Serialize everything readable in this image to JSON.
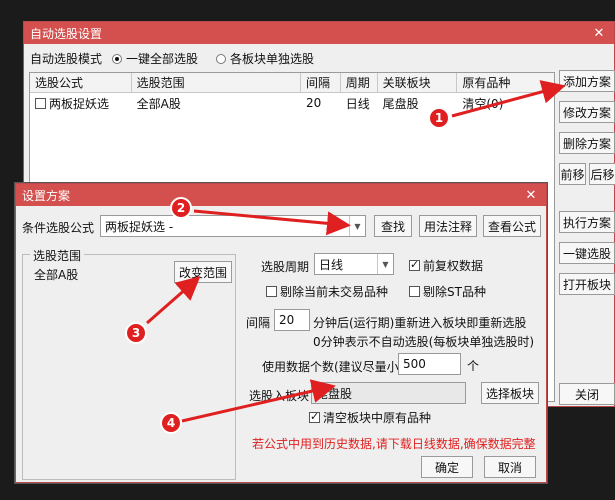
{
  "back_window": {
    "title": "自动选股设置",
    "mode_label": "自动选股模式",
    "mode_options": [
      "一键全部选股",
      "各板块单独选股"
    ],
    "table": {
      "headers": [
        "选股公式",
        "选股范围",
        "间隔",
        "周期",
        "关联板块",
        "原有品种"
      ],
      "rows": [
        {
          "formula": "两板捉妖选",
          "range": "全部A股",
          "interval": "20",
          "period": "日线",
          "block": "尾盘股",
          "original": "清空(0)"
        }
      ]
    },
    "buttons": {
      "add": "添加方案",
      "modify": "修改方案",
      "delete": "删除方案",
      "move_up": "前移",
      "move_down": "后移",
      "execute": "执行方案",
      "one_click": "一键选股",
      "open_block": "打开板块",
      "close": "关闭"
    }
  },
  "dialog": {
    "title": "设置方案",
    "condition_label": "条件选股公式",
    "condition_value": "两板捉妖选 -",
    "find": "查找",
    "usage": "用法注释",
    "view_formula": "查看公式",
    "range_group": "选股范围",
    "range_value": "全部A股",
    "change_range": "改变范围",
    "period_label": "选股周期",
    "period_value": "日线",
    "pre_adjust": "前复权数据",
    "exclude_untraded": "剔除当前未交易品种",
    "exclude_st": "剔除ST品种",
    "interval_label": "间隔",
    "interval_value": "20",
    "interval_suffix": "分钟后(运行期)重新进入板块即重新选股",
    "interval_note": "0分钟表示不自动选股(每板块单独选股时)",
    "data_count_label": "使用数据个数(建议尽量小)",
    "data_count_value": "500",
    "data_count_unit": "个",
    "block_label": "选股入板块",
    "block_value": "尾盘股",
    "select_block": "选择板块",
    "clear_block": "清空板块中原有品种",
    "warning": "若公式中用到历史数据,请下载日线数据,确保数据完整",
    "ok": "确定",
    "cancel": "取消"
  },
  "annotations": [
    "1",
    "2",
    "3",
    "4"
  ],
  "colors": {
    "title_bar": "#d4504f",
    "annotation": "#e02020",
    "warning": "#e02020"
  }
}
